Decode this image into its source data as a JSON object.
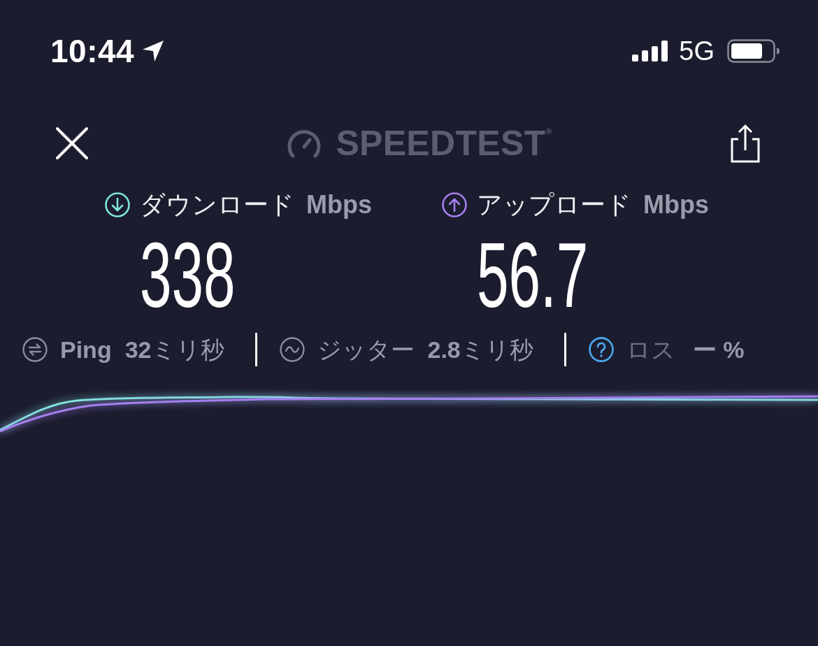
{
  "status_bar": {
    "time": "10:44",
    "network": "5G"
  },
  "header": {
    "logo": "SPEEDTEST$^{®}$"
  },
  "results": [
    {
      "kind": "download",
      "label": "ダウンロード",
      "unit": "Mbps",
      "value": "338",
      "color": "#7fe6de"
    },
    {
      "kind": "upload",
      "label": "アップロード",
      "unit": "Mbps",
      "value": "56.7",
      "color": "#a77ff0"
    }
  ],
  "stats": [
    {
      "kind": "ping",
      "label": "Ping",
      "value": "**32**ミリ秒"
    },
    {
      "kind": "jitter",
      "label": "ジッター",
      "value": "**2.8**ミリ秒"
    },
    {
      "kind": "loss",
      "label": "ロス",
      "value": "ー %"
    }
  ]
}
